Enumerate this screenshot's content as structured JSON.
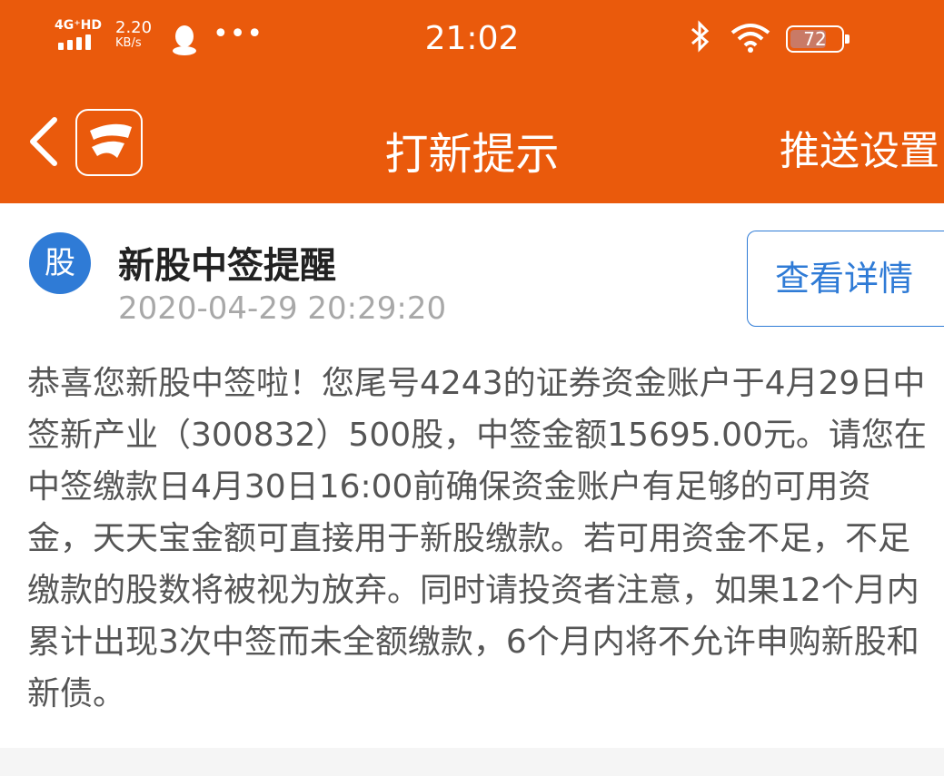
{
  "status_bar": {
    "network": "4G⁺HD",
    "speed_value": "2.20",
    "speed_unit": "KB/s",
    "time": "21:02",
    "battery_level": 72,
    "battery_text": "72",
    "icons": [
      "signal-icon",
      "qq-icon",
      "more-dots-icon",
      "bluetooth-icon",
      "wifi-icon",
      "battery-icon"
    ]
  },
  "header": {
    "back_icon": "chevron-left-icon",
    "app_logo": "app-logo-icon",
    "title": "打新提示",
    "right_action": "推送设置"
  },
  "notification": {
    "avatar_text": "股",
    "title": "新股中签提醒",
    "timestamp": "2020-04-29 20:29:20",
    "detail_button": "查看详情",
    "body": "恭喜您新股中签啦！您尾号4243的证券资金账户于4月29日中签新产业（300832）500股，中签金额15695.00元。请您在中签缴款日4月30日16:00前确保资金账户有足够的可用资金，天天宝金额可直接用于新股缴款。若可用资金不足，不足缴款的股数将被视为放弃。同时请投资者注意，如果12个月内累计出现3次中签而未全额缴款，6个月内将不允许申购新股和新债。"
  },
  "colors": {
    "brand_orange": "#ea5a0c",
    "accent_blue": "#2f7bd6",
    "page_bg": "#f5f5f5"
  }
}
